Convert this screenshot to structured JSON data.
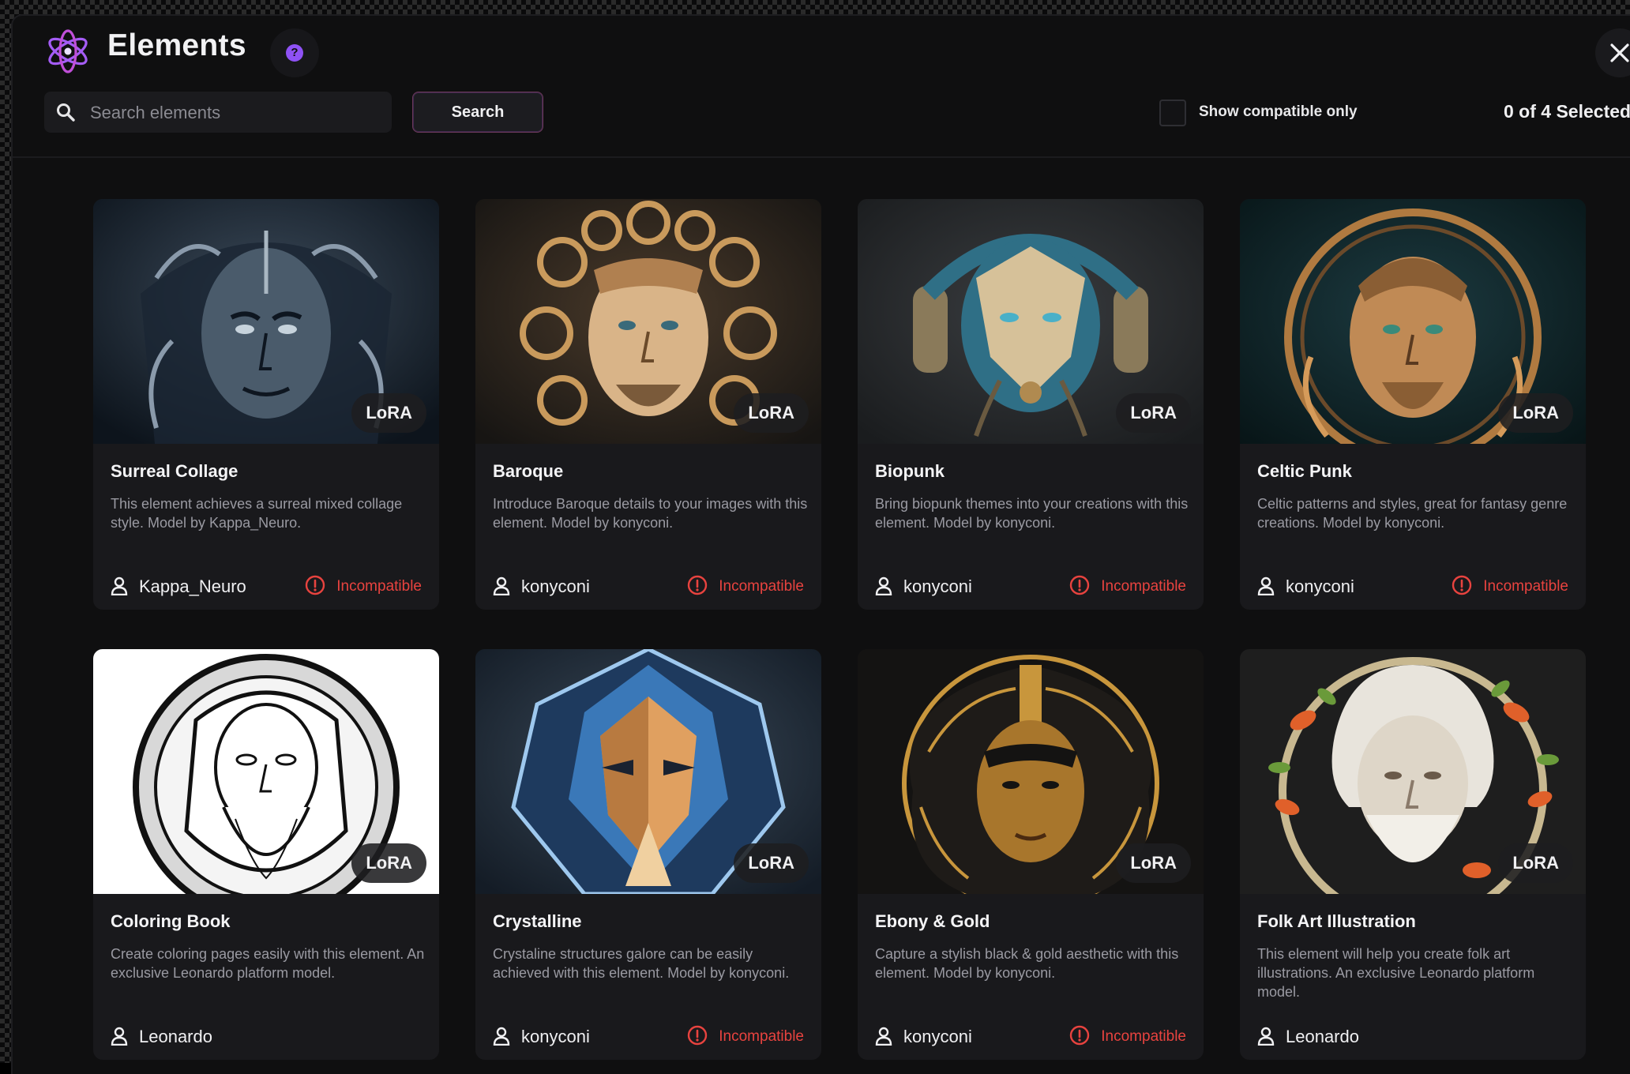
{
  "header": {
    "title": "Elements",
    "help_icon": "?",
    "close_icon": "close-icon"
  },
  "toolbar": {
    "search_placeholder": "Search elements",
    "search_value": "",
    "search_button_label": "Search",
    "compatible_checkbox_checked": false,
    "compatible_label": "Show compatible only",
    "selected_count": "0 of 4 Selected"
  },
  "colors": {
    "accent_purple": "#8f52f5",
    "incompatible_red": "#e8433f",
    "background": "#0f0f10",
    "card": "#19191c"
  },
  "cards": [
    {
      "title": "Surreal Collage",
      "badge": "LoRA",
      "description": "This element achieves a surreal mixed collage style. Model by Kappa_Neuro.",
      "author": "Kappa_Neuro",
      "compat": "Incompatible",
      "image": "surreal-collage-portrait",
      "palette": [
        "#1d2a38",
        "#556678",
        "#a9b7c2"
      ]
    },
    {
      "title": "Baroque",
      "badge": "LoRA",
      "description": "Introduce Baroque details to your images with this element. Model by konyconi.",
      "author": "konyconi",
      "compat": "Incompatible",
      "image": "baroque-portrait",
      "palette": [
        "#1e1c1a",
        "#7a5a3a",
        "#d8b07a"
      ]
    },
    {
      "title": "Biopunk",
      "badge": "LoRA",
      "description": "Bring biopunk themes into your creations with this element. Model by konyconi.",
      "author": "konyconi",
      "compat": "Incompatible",
      "image": "biopunk-portrait",
      "palette": [
        "#2a2d2f",
        "#2f6f86",
        "#d6c199"
      ]
    },
    {
      "title": "Celtic Punk",
      "badge": "LoRA",
      "description": "Celtic patterns and styles, great for fantasy genre creations. Model by konyconi.",
      "author": "konyconi",
      "compat": "Incompatible",
      "image": "celtic-punk-portrait",
      "palette": [
        "#0f2a30",
        "#6b4a2a",
        "#d59b5a"
      ]
    },
    {
      "title": "Coloring Book",
      "badge": "LoRA",
      "description": "Create coloring pages easily with this element. An exclusive Leonardo platform model.",
      "author": "Leonardo",
      "compat": "",
      "image": "coloring-book-portrait",
      "palette": [
        "#ffffff",
        "#888888",
        "#111111"
      ]
    },
    {
      "title": "Crystalline",
      "badge": "LoRA",
      "description": "Crystaline structures galore can be easily achieved with this element. Model by konyconi.",
      "author": "konyconi",
      "compat": "Incompatible",
      "image": "crystalline-portrait",
      "palette": [
        "#1a2230",
        "#3a78b8",
        "#e0a060"
      ]
    },
    {
      "title": "Ebony & Gold",
      "badge": "LoRA",
      "description": "Capture a stylish black & gold aesthetic with this element. Model by konyconi.",
      "author": "konyconi",
      "compat": "Incompatible",
      "image": "ebony-gold-portrait",
      "palette": [
        "#141312",
        "#2a2520",
        "#c8963c"
      ]
    },
    {
      "title": "Folk Art Illustration",
      "badge": "LoRA",
      "description": "This element will help you create folk art illustrations. An exclusive Leonardo platform model.",
      "author": "Leonardo",
      "compat": "",
      "image": "folk-art-portrait",
      "palette": [
        "#1e1e1e",
        "#e8e4dc",
        "#e0602a"
      ]
    }
  ]
}
